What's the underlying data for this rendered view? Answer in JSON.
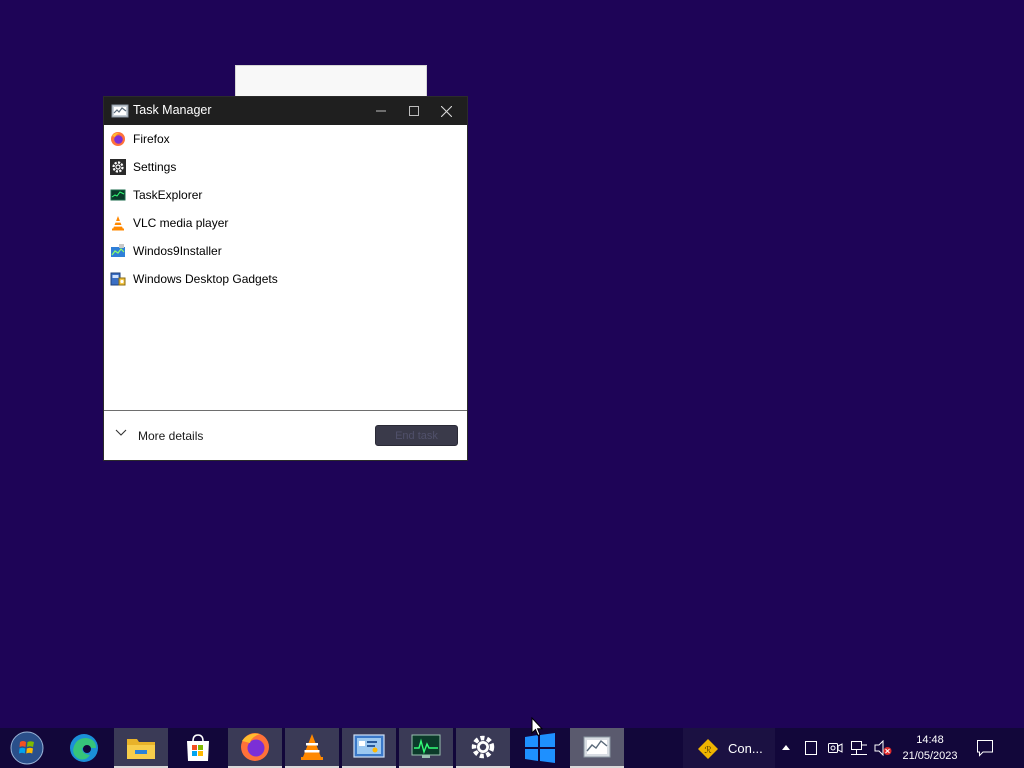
{
  "desktop": {
    "background": "#1e0457"
  },
  "task_manager": {
    "title": "Task Manager",
    "apps": [
      {
        "label": "Firefox",
        "icon": "firefox-icon"
      },
      {
        "label": "Settings",
        "icon": "settings-gear-icon"
      },
      {
        "label": "TaskExplorer",
        "icon": "taskexplorer-icon"
      },
      {
        "label": "VLC media player",
        "icon": "vlc-icon"
      },
      {
        "label": "Windos9Installer",
        "icon": "installer-icon"
      },
      {
        "label": "Windows Desktop Gadgets",
        "icon": "gadgets-icon"
      }
    ],
    "more_details_label": "More details",
    "end_task_label": "End task"
  },
  "taskbar": {
    "pinned": [
      "start-orb-icon",
      "edge-icon",
      "file-explorer-icon",
      "store-icon",
      "firefox-icon",
      "vlc-icon",
      "control-panel-icon",
      "task-manager-app-icon",
      "settings-gear-icon",
      "windows-logo-icon",
      "task-manager-icon"
    ],
    "notification_label": "Con...",
    "clock_time": "14:48",
    "clock_date": "21/05/2023"
  }
}
